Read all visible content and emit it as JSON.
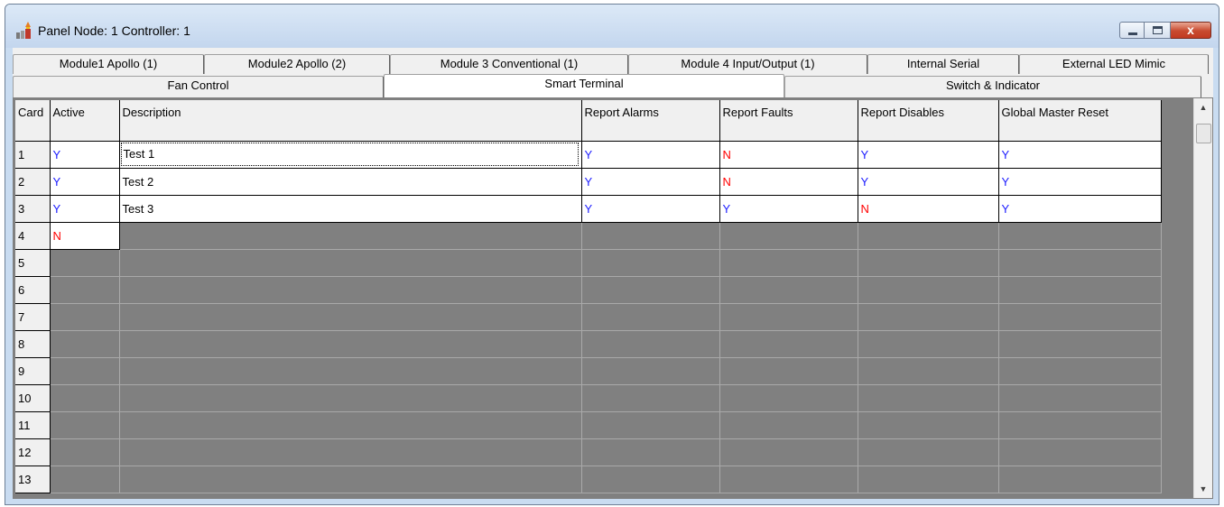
{
  "window": {
    "title": "Panel Node: 1 Controller: 1",
    "icon": "fire-panel-icon",
    "controls": {
      "minimize": "minimize-icon",
      "maximize": "maximize-icon",
      "close_glyph": "x"
    }
  },
  "tabs_row1": [
    {
      "label": "Module1 Apollo (1)"
    },
    {
      "label": "Module2 Apollo (2)"
    },
    {
      "label": "Module 3 Conventional (1)"
    },
    {
      "label": "Module 4 Input/Output (1)"
    },
    {
      "label": "Internal Serial"
    },
    {
      "label": "External LED Mimic"
    }
  ],
  "tabs_row2": [
    {
      "label": "Fan Control"
    },
    {
      "label": "Smart Terminal",
      "selected": true
    },
    {
      "label": "Switch & Indicator"
    }
  ],
  "grid": {
    "headers": [
      "Card",
      "Active",
      "Description",
      "Report Alarms",
      "Report Faults",
      "Report Disables",
      "Global Master Reset"
    ],
    "rows": [
      {
        "card": "1",
        "active": "Y",
        "description": "Test 1",
        "alarms": "Y",
        "faults": "N",
        "disables": "Y",
        "reset": "Y"
      },
      {
        "card": "2",
        "active": "Y",
        "description": "Test 2",
        "alarms": "Y",
        "faults": "N",
        "disables": "Y",
        "reset": "Y"
      },
      {
        "card": "3",
        "active": "Y",
        "description": "Test 3",
        "alarms": "Y",
        "faults": "Y",
        "disables": "N",
        "reset": "Y"
      },
      {
        "card": "4",
        "active": "N"
      },
      {
        "card": "5"
      },
      {
        "card": "6"
      },
      {
        "card": "7"
      },
      {
        "card": "8"
      },
      {
        "card": "9"
      },
      {
        "card": "10"
      },
      {
        "card": "11"
      },
      {
        "card": "12"
      },
      {
        "card": "13"
      }
    ]
  },
  "colors": {
    "yes": "#1a1aff",
    "no": "#ff0000",
    "disabled_cell": "#808080"
  }
}
